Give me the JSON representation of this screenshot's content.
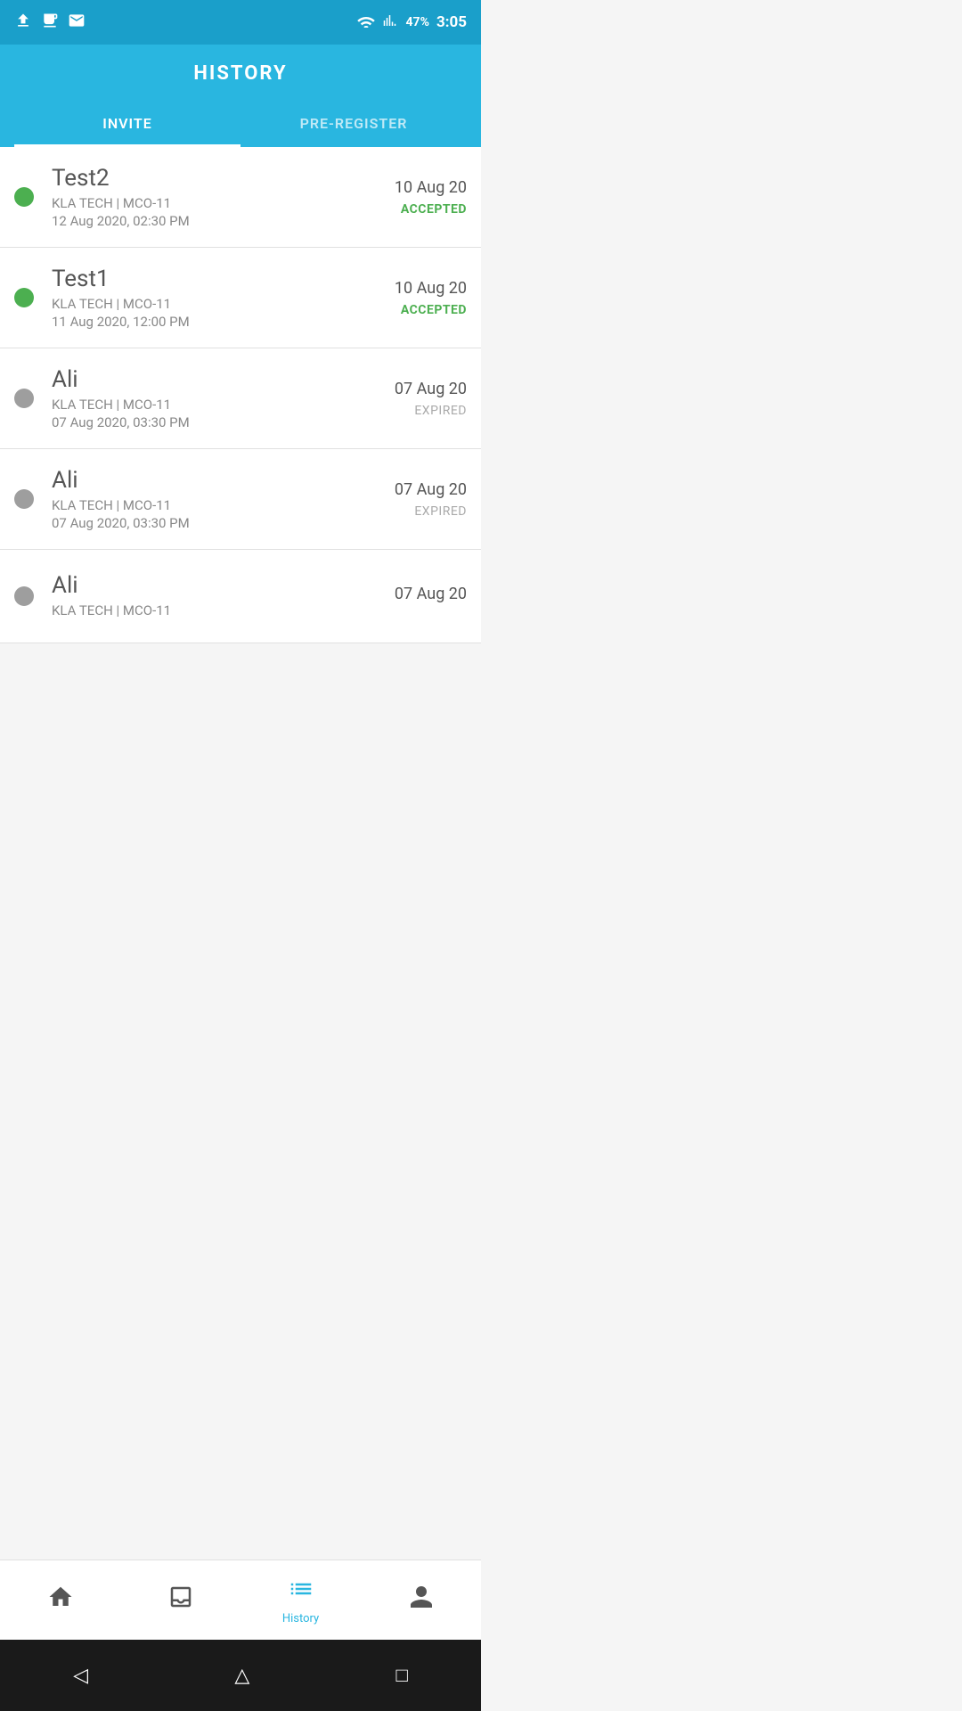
{
  "statusBar": {
    "battery": "47%",
    "time": "3:05"
  },
  "header": {
    "title": "HISTORY"
  },
  "tabs": [
    {
      "id": "invite",
      "label": "INVITE",
      "active": true
    },
    {
      "id": "preregister",
      "label": "PRE-REGISTER",
      "active": false
    }
  ],
  "listItems": [
    {
      "id": 1,
      "name": "Test2",
      "company": "KLA TECH  | MCO-11",
      "datetime": "12 Aug 2020, 02:30 PM",
      "dateRight": "10 Aug 20",
      "status": "ACCEPTED",
      "statusType": "accepted",
      "dotColor": "green"
    },
    {
      "id": 2,
      "name": "Test1",
      "company": "KLA TECH  | MCO-11",
      "datetime": "11 Aug 2020, 12:00 PM",
      "dateRight": "10 Aug 20",
      "status": "ACCEPTED",
      "statusType": "accepted",
      "dotColor": "green"
    },
    {
      "id": 3,
      "name": "Ali",
      "company": "KLA TECH  | MCO-11",
      "datetime": "07 Aug 2020, 03:30 PM",
      "dateRight": "07 Aug 20",
      "status": "EXPIRED",
      "statusType": "expired",
      "dotColor": "gray"
    },
    {
      "id": 4,
      "name": "Ali",
      "company": "KLA TECH  | MCO-11",
      "datetime": "07 Aug 2020, 03:30 PM",
      "dateRight": "07 Aug 20",
      "status": "EXPIRED",
      "statusType": "expired",
      "dotColor": "gray"
    },
    {
      "id": 5,
      "name": "Ali",
      "company": "KLA TECH  | MCO-11",
      "datetime": "",
      "dateRight": "07 Aug 20",
      "status": "",
      "statusType": "expired",
      "dotColor": "gray"
    }
  ],
  "bottomNav": [
    {
      "id": "home",
      "label": "",
      "icon": "home",
      "active": false
    },
    {
      "id": "inbox",
      "label": "",
      "icon": "inbox",
      "active": false
    },
    {
      "id": "history",
      "label": "History",
      "icon": "history",
      "active": true
    },
    {
      "id": "profile",
      "label": "",
      "icon": "profile",
      "active": false
    }
  ],
  "androidNav": {
    "back": "◁",
    "home": "△",
    "recents": "□"
  }
}
